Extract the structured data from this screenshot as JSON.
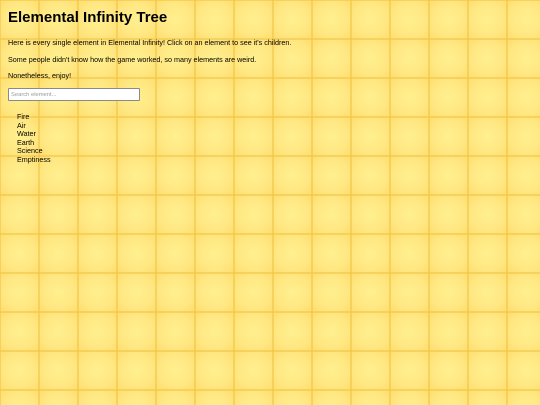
{
  "page": {
    "title": "Elemental Infinity Tree",
    "intro": "Here is every single element in Elemental Infinity! Click on an element to see it's children.",
    "note": "Some people didn't know how the game worked, so many elements are weird.",
    "outro": "Nonetheless, enjoy!"
  },
  "search": {
    "placeholder": "Search element...",
    "value": ""
  },
  "elements": [
    "Fire",
    "Air",
    "Water",
    "Earth",
    "Science",
    "Emptiness"
  ],
  "colors": {
    "background": "#ffe27a",
    "grid_line": "#eec446",
    "text": "#000000"
  }
}
